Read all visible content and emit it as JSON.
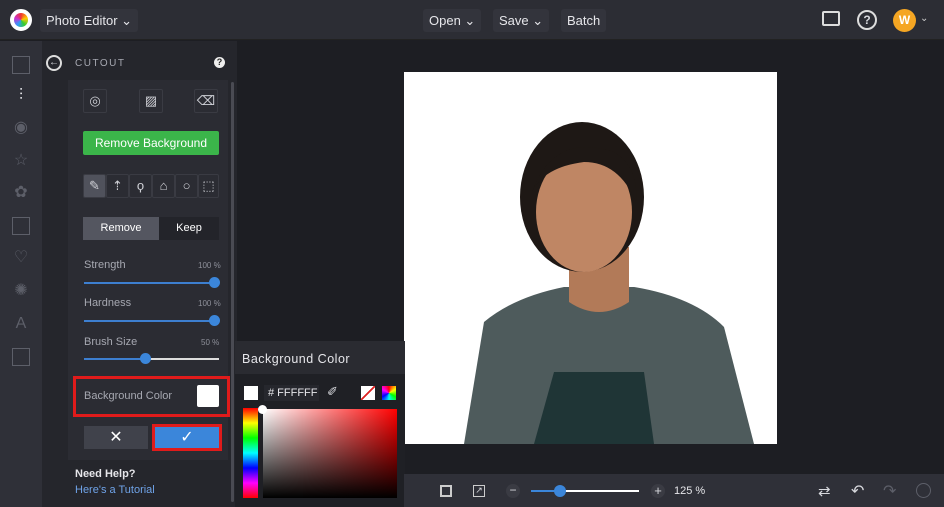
{
  "topbar": {
    "app_menu": "Photo Editor ⌄",
    "open": "Open ⌄",
    "save": "Save ⌄",
    "batch": "Batch",
    "avatar_initial": "W"
  },
  "panel": {
    "title": "CUTOUT",
    "help": "?",
    "remove_bg": "Remove Background",
    "remove": "Remove",
    "keep": "Keep",
    "sliders": [
      {
        "label": "Strength",
        "value": "100 %",
        "fraction": 1.0
      },
      {
        "label": "Hardness",
        "value": "100 %",
        "fraction": 1.0
      },
      {
        "label": "Brush Size",
        "value": "50 %",
        "fraction": 0.5
      }
    ],
    "bg_color_label": "Background Color",
    "need_help": "Need Help?",
    "tutorial": "Here's a Tutorial"
  },
  "popup": {
    "title": "Background Color",
    "hex": "# FFFFFF"
  },
  "bottom": {
    "zoom": "125 %",
    "zoom_fraction": 0.2
  },
  "colors": {
    "accent": "#3b86da",
    "green": "#3bb54a",
    "highlight": "#e01b1b",
    "avatar": "#f5a623"
  }
}
